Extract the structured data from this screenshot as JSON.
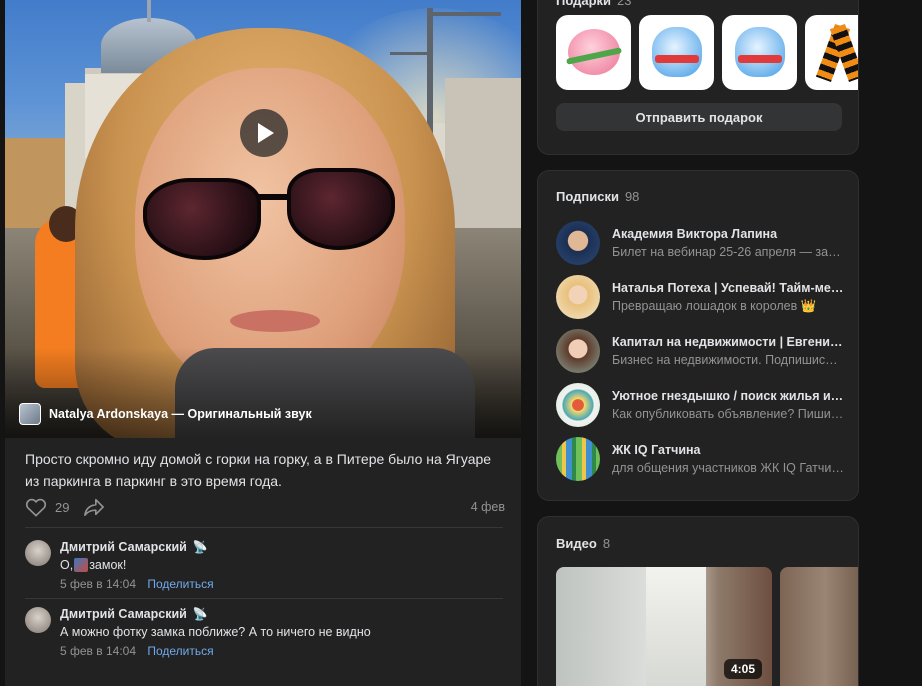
{
  "post": {
    "audio": {
      "author": "Natalya Ardonskaya",
      "sound": "Оригинальный звук",
      "text": "Natalya Ardonskaya — Оригинальный звук"
    },
    "text": "Просто скромно иду домой с горки на горку, а в Питере было на Ягуаре из паркинга в паркинг в это время года.",
    "likes": "29",
    "date": "4 фев",
    "comments": [
      {
        "author": "Дмитрий Самарский",
        "text_before": "О, ",
        "text_after": "замок!",
        "time": "5 фев в 14:04",
        "share": "Поделиться"
      },
      {
        "author": "Дмитрий Самарский",
        "text_before": "А можно фотку замка поближе? А то ничего не видно",
        "text_after": "",
        "time": "5 фев в 14:04",
        "share": "Поделиться"
      }
    ]
  },
  "gifts": {
    "title": "Подарки",
    "count": "23",
    "items": [
      "pig-gift",
      "cat-gift",
      "cat-gift",
      "st-george-ribbon-gift"
    ],
    "send_button": "Отправить подарок"
  },
  "subscriptions": {
    "title": "Подписки",
    "count": "98",
    "items": [
      {
        "name": "Академия Виктора Лапина",
        "desc": "Билет на вебинар 25-26 апреля — забе…",
        "color": "#2b4a7a"
      },
      {
        "name": "Наталья Потеха | Успевай! Тайм-мене…",
        "desc": "Превращаю лошадок в королев 👑",
        "color": "#e8d3a8"
      },
      {
        "name": "Капитал на недвижимости | Евгения Ф…",
        "desc": "Бизнес на недвижимости. Подпишись…",
        "color": "#5a8a78"
      },
      {
        "name": "Уютное гнездышко / поиск жилья и с…",
        "desc": "Как опубликовать объявление? Пиши …",
        "color": "#4aa8b8"
      },
      {
        "name": "ЖК IQ Гатчина",
        "desc": "для общения участников ЖК IQ Гатчина",
        "color": "#6fbf5a"
      }
    ]
  },
  "videos": {
    "title": "Видео",
    "count": "8",
    "items": [
      {
        "duration": "4:05"
      },
      {
        "duration": ""
      }
    ]
  }
}
